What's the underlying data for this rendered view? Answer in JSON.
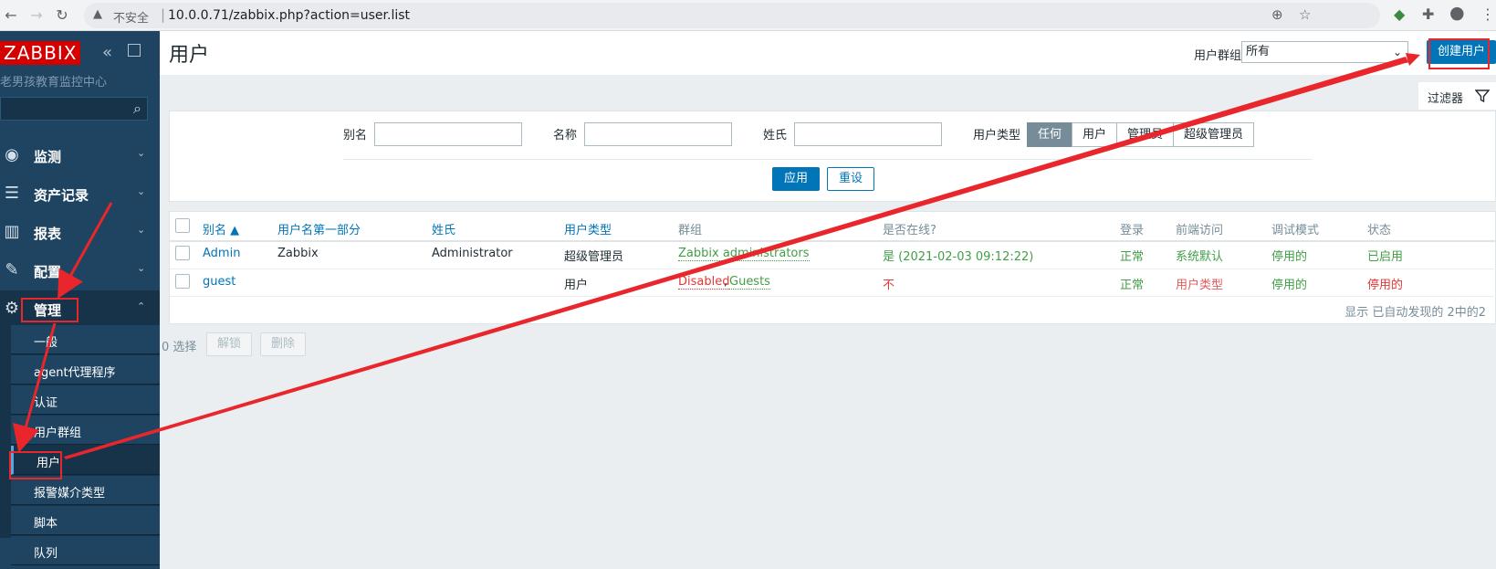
{
  "browser": {
    "security_label": "不安全",
    "url": "10.0.0.71/zabbix.php?action=user.list"
  },
  "sidebar": {
    "logo": "ZABBIX",
    "server_name": "老男孩教育监控中心",
    "menu": [
      {
        "label": "监测",
        "icon": "eye-icon"
      },
      {
        "label": "资产记录",
        "icon": "list-icon"
      },
      {
        "label": "报表",
        "icon": "bar-chart-icon"
      },
      {
        "label": "配置",
        "icon": "wrench-icon"
      },
      {
        "label": "管理",
        "icon": "gear-icon"
      }
    ],
    "submenu": [
      {
        "label": "一般"
      },
      {
        "label": "agent代理程序"
      },
      {
        "label": "认证"
      },
      {
        "label": "用户群组"
      },
      {
        "label": "用户"
      },
      {
        "label": "报警媒介类型"
      },
      {
        "label": "脚本"
      },
      {
        "label": "队列"
      }
    ]
  },
  "header": {
    "title": "用户",
    "usergroup_label": "用户群组",
    "usergroup_value": "所有",
    "create_button": "创建用户"
  },
  "filter": {
    "tab_label": "过滤器",
    "alias_label": "别名",
    "name_label": "名称",
    "surname_label": "姓氏",
    "type_label": "用户类型",
    "type_options": [
      "任何",
      "用户",
      "管理员",
      "超级管理员"
    ],
    "type_selected": "任何",
    "apply": "应用",
    "reset": "重设"
  },
  "table": {
    "columns": [
      "别名 ▲",
      "用户名第一部分",
      "姓氏",
      "用户类型",
      "群组",
      "是否在线?",
      "登录",
      "前端访问",
      "调试模式",
      "状态"
    ],
    "rows": [
      {
        "alias": "Admin",
        "name": "Zabbix",
        "surname": "Administrator",
        "type": "超级管理员",
        "groups": [
          "Zabbix administrators"
        ],
        "online": "是 (2021-02-03 09:12:22)",
        "login": "正常",
        "frontend": "系统默认",
        "debug": "停用的",
        "status": "已启用"
      },
      {
        "alias": "guest",
        "name": "",
        "surname": "",
        "type": "用户",
        "groups": [
          "Disabled",
          "Guests"
        ],
        "online": "不",
        "login": "正常",
        "frontend": "用户类型",
        "debug": "停用的",
        "status": "停用的"
      }
    ],
    "group_separator": ",",
    "footer": "显示 已自动发现的 2中的2"
  },
  "actions": {
    "selected": "0 选择",
    "unlock": "解锁",
    "delete": "删除"
  },
  "colors": {
    "sidebar_bg": "#1f4461",
    "brand_red": "#d40000",
    "link_blue": "#0275b8",
    "ok_green": "#429e47",
    "alert_red": "#e33734",
    "annotation_red": "#e8262b"
  }
}
